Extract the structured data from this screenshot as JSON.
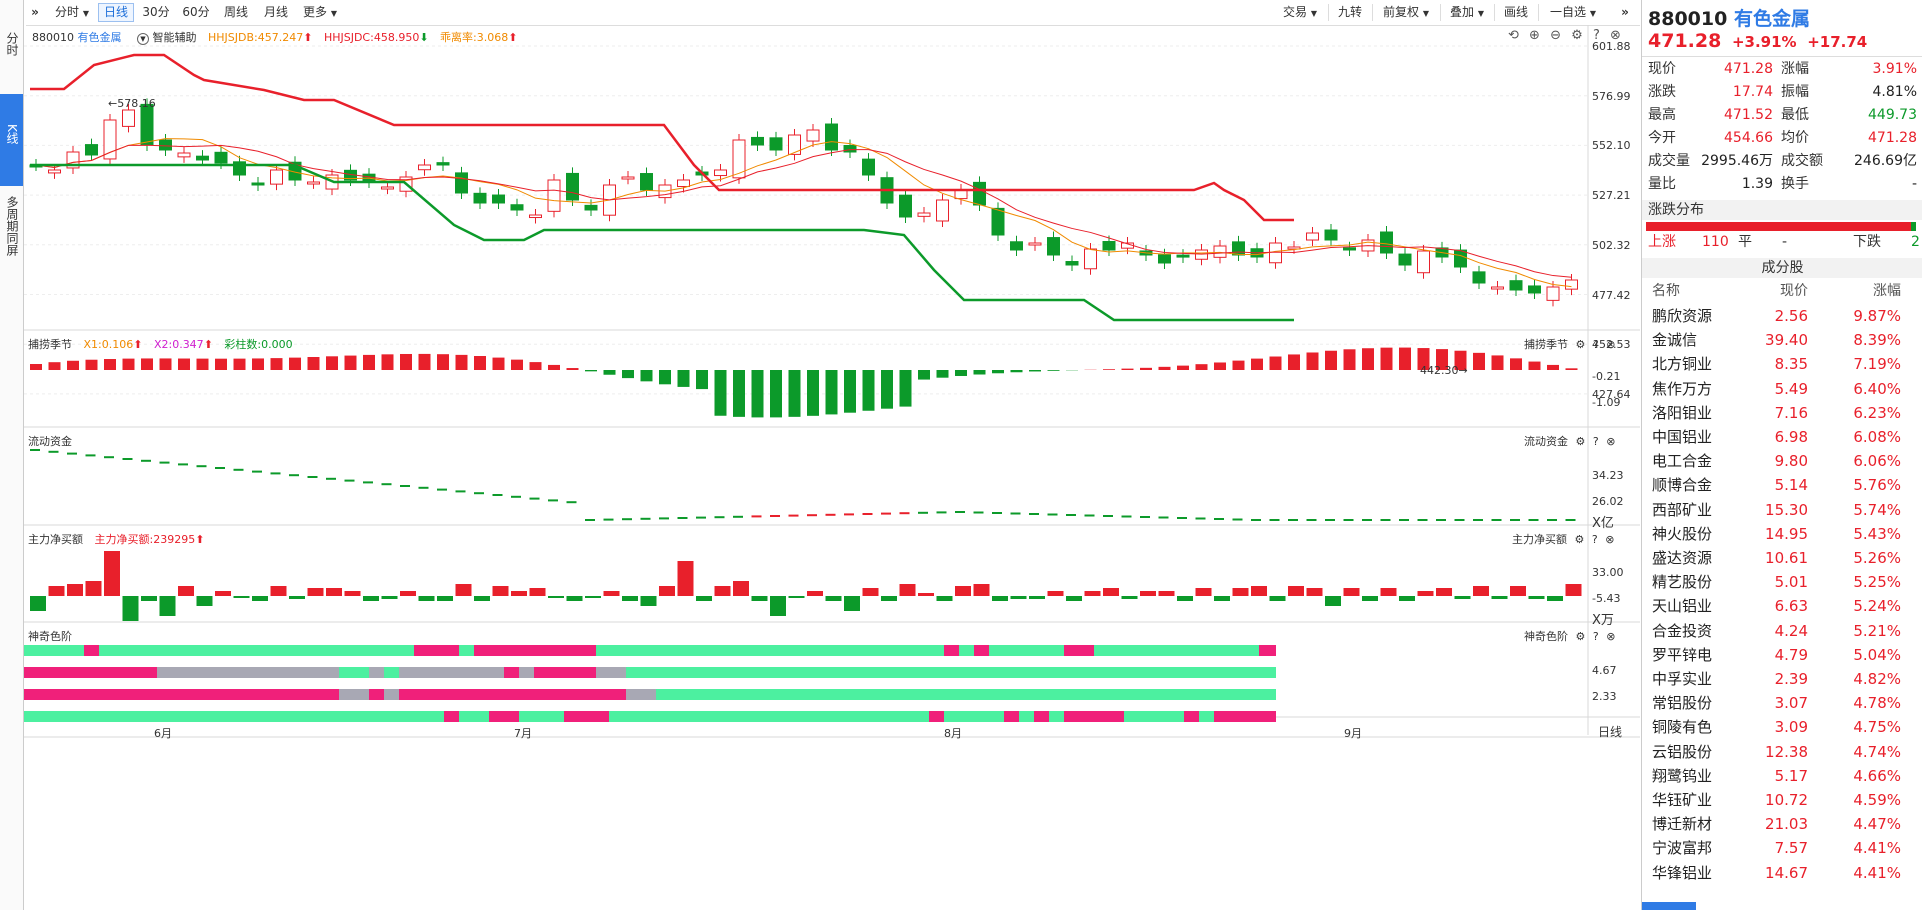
{
  "toolbar": {
    "collapse_icon": "double-chevron-right-icon",
    "fenshi": "分时",
    "rixian": "日线",
    "m30": "30分",
    "m60": "60分",
    "zhouxian": "周线",
    "yuexian": "月线",
    "more": "更多",
    "jiaoyi": "交易",
    "jiuzhuan": "九转",
    "qianfuquan": "前复权",
    "diejia": "叠加",
    "huaxian": "画线",
    "zixuan": "一自选"
  },
  "left_tabs": {
    "fenshi": "分时",
    "kxian": "K线",
    "duozhouqi": "多周期同屏"
  },
  "main_panel": {
    "code": "880010",
    "name": "有色金属",
    "assist": "智能辅助",
    "ind1": "HHJSJDB:457.247",
    "ind2": "HHJSJDC:458.950",
    "ind3": "乖离率:3.068",
    "high_mark": "578.16",
    "low_mark": "442.30",
    "yaxis": [
      "601.88",
      "576.99",
      "552.10",
      "527.21",
      "502.32",
      "477.42",
      "452.53",
      "427.64"
    ]
  },
  "panel2": {
    "title": "捕捞季节",
    "x1": "X1:0.106",
    "x2": "X2:0.347",
    "caizhu": "彩柱数:0.000",
    "right_title": "捕捞季节",
    "yaxis": [
      "-0.21",
      "-1.09"
    ]
  },
  "panel3": {
    "title": "流动资金",
    "right_title": "流动资金",
    "yaxis": [
      "34.23",
      "26.02"
    ],
    "unit": "X亿"
  },
  "panel4": {
    "title": "主力净买额",
    "value": "主力净买额:239295",
    "right_title": "主力净买额",
    "yaxis": [
      "33.00",
      "-5.43"
    ],
    "unit": "X万"
  },
  "panel5": {
    "title": "神奇色阶",
    "right_title": "神奇色阶",
    "yaxis": [
      "4.67",
      "2.33"
    ]
  },
  "xaxis": {
    "months": [
      "6月",
      "7月",
      "8月",
      "9月"
    ],
    "period": "日线"
  },
  "quote": {
    "code": "880010",
    "name": "有色金属",
    "price": "471.28",
    "pct": "+3.91%",
    "change": "+17.74",
    "rows": [
      {
        "k1": "现价",
        "v1": "471.28",
        "c1": "red",
        "k2": "涨幅",
        "v2": "3.91%",
        "c2": "red"
      },
      {
        "k1": "涨跌",
        "v1": "17.74",
        "c1": "red",
        "k2": "振幅",
        "v2": "4.81%",
        "c2": "black"
      },
      {
        "k1": "最高",
        "v1": "471.52",
        "c1": "red",
        "k2": "最低",
        "v2": "449.73",
        "c2": "green"
      },
      {
        "k1": "今开",
        "v1": "454.66",
        "c1": "red",
        "k2": "均价",
        "v2": "471.28",
        "c2": "red"
      },
      {
        "k1": "成交量",
        "v1": "2995.46万",
        "c1": "black",
        "k2": "成交额",
        "v2": "246.69亿",
        "c2": "black"
      },
      {
        "k1": "量比",
        "v1": "1.39",
        "c1": "black",
        "k2": "换手",
        "v2": "-",
        "c2": "black"
      }
    ]
  },
  "distribution": {
    "title": "涨跌分布",
    "up_label": "上涨",
    "up_count": "110",
    "flat_label": "平",
    "flat_count": "-",
    "down_label": "下跌",
    "down_count": "2",
    "up_ratio": 0.982
  },
  "constituents": {
    "title": "成分股",
    "headers": [
      "名称",
      "现价",
      "涨幅"
    ],
    "rows": [
      {
        "name": "鹏欣资源",
        "price": "2.56",
        "pct": "9.87%"
      },
      {
        "name": "金诚信",
        "price": "39.40",
        "pct": "8.39%"
      },
      {
        "name": "北方铜业",
        "price": "8.35",
        "pct": "7.19%"
      },
      {
        "name": "焦作万方",
        "price": "5.49",
        "pct": "6.40%"
      },
      {
        "name": "洛阳钼业",
        "price": "7.16",
        "pct": "6.23%"
      },
      {
        "name": "中国铝业",
        "price": "6.98",
        "pct": "6.08%"
      },
      {
        "name": "电工合金",
        "price": "9.80",
        "pct": "6.06%"
      },
      {
        "name": "顺博合金",
        "price": "5.14",
        "pct": "5.76%"
      },
      {
        "name": "西部矿业",
        "price": "15.30",
        "pct": "5.74%"
      },
      {
        "name": "神火股份",
        "price": "14.95",
        "pct": "5.43%"
      },
      {
        "name": "盛达资源",
        "price": "10.61",
        "pct": "5.26%"
      },
      {
        "name": "精艺股份",
        "price": "5.01",
        "pct": "5.25%"
      },
      {
        "name": "天山铝业",
        "price": "6.63",
        "pct": "5.24%"
      },
      {
        "name": "合金投资",
        "price": "4.24",
        "pct": "5.21%"
      },
      {
        "name": "罗平锌电",
        "price": "4.79",
        "pct": "5.04%"
      },
      {
        "name": "中孚实业",
        "price": "2.39",
        "pct": "4.82%"
      },
      {
        "name": "常铝股份",
        "price": "3.07",
        "pct": "4.78%"
      },
      {
        "name": "铜陵有色",
        "price": "3.09",
        "pct": "4.75%"
      },
      {
        "name": "云铝股份",
        "price": "12.38",
        "pct": "4.74%"
      },
      {
        "name": "翔鹭钨业",
        "price": "5.17",
        "pct": "4.66%"
      },
      {
        "name": "华钰矿业",
        "price": "10.72",
        "pct": "4.59%"
      },
      {
        "name": "博迁新材",
        "price": "21.03",
        "pct": "4.47%"
      },
      {
        "name": "宁波富邦",
        "price": "7.57",
        "pct": "4.41%"
      },
      {
        "name": "华锋铝业",
        "price": "14.67",
        "pct": "4.41%"
      }
    ]
  },
  "colors": {
    "up": "#e8202b",
    "down": "#0c9a2a",
    "accent": "#2f7be5",
    "teal": "#4cf0a0",
    "magenta": "#f0207a",
    "gray": "#a8a8b4"
  }
}
